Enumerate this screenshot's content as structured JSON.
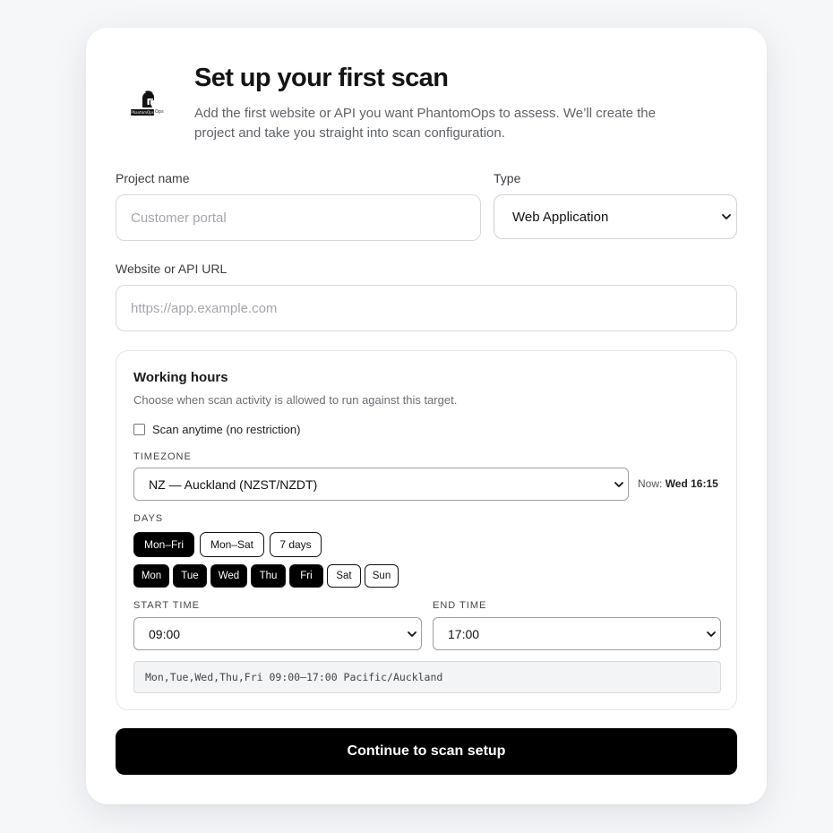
{
  "header": {
    "title": "Set up your first scan",
    "subtitle": "Add the first website or API you want PhantomOps to assess. We’ll create the project and take you straight into scan configuration.",
    "logo_plate_text": "PhantomOps",
    "logo_suffix_text": "Ops",
    "logo_icon": "spartan-helmet-icon"
  },
  "form": {
    "project_name": {
      "label": "Project name",
      "placeholder": "Customer portal",
      "value": ""
    },
    "type": {
      "label": "Type",
      "selected": "Web Application"
    },
    "url": {
      "label": "Website or API URL",
      "placeholder": "https://app.example.com",
      "value": ""
    }
  },
  "working_hours": {
    "title": "Working hours",
    "description": "Choose when scan activity is allowed to run against this target.",
    "anytime_label": "Scan anytime (no restriction)",
    "anytime_checked": false,
    "timezone": {
      "caption": "TIMEZONE",
      "selected": "NZ — Auckland (NZST/NZDT)",
      "now_label": "Now:",
      "now_value": "Wed 16:15"
    },
    "days": {
      "caption": "DAYS",
      "presets": [
        {
          "label": "Mon–Fri",
          "active": true
        },
        {
          "label": "Mon–Sat",
          "active": false
        },
        {
          "label": "7 days",
          "active": false
        }
      ],
      "items": [
        {
          "label": "Mon",
          "active": true
        },
        {
          "label": "Tue",
          "active": true
        },
        {
          "label": "Wed",
          "active": true
        },
        {
          "label": "Thu",
          "active": true
        },
        {
          "label": "Fri",
          "active": true
        },
        {
          "label": "Sat",
          "active": false
        },
        {
          "label": "Sun",
          "active": false
        }
      ]
    },
    "start_time": {
      "caption": "START TIME",
      "selected": "09:00"
    },
    "end_time": {
      "caption": "END TIME",
      "selected": "17:00"
    },
    "summary": "Mon,Tue,Wed,Thu,Fri 09:00–17:00 Pacific/Auckland"
  },
  "cta": {
    "label": "Continue to scan setup"
  },
  "colors": {
    "primary": "#000000",
    "page_bg": "#f6f7f9",
    "muted_text": "#5f6368"
  }
}
